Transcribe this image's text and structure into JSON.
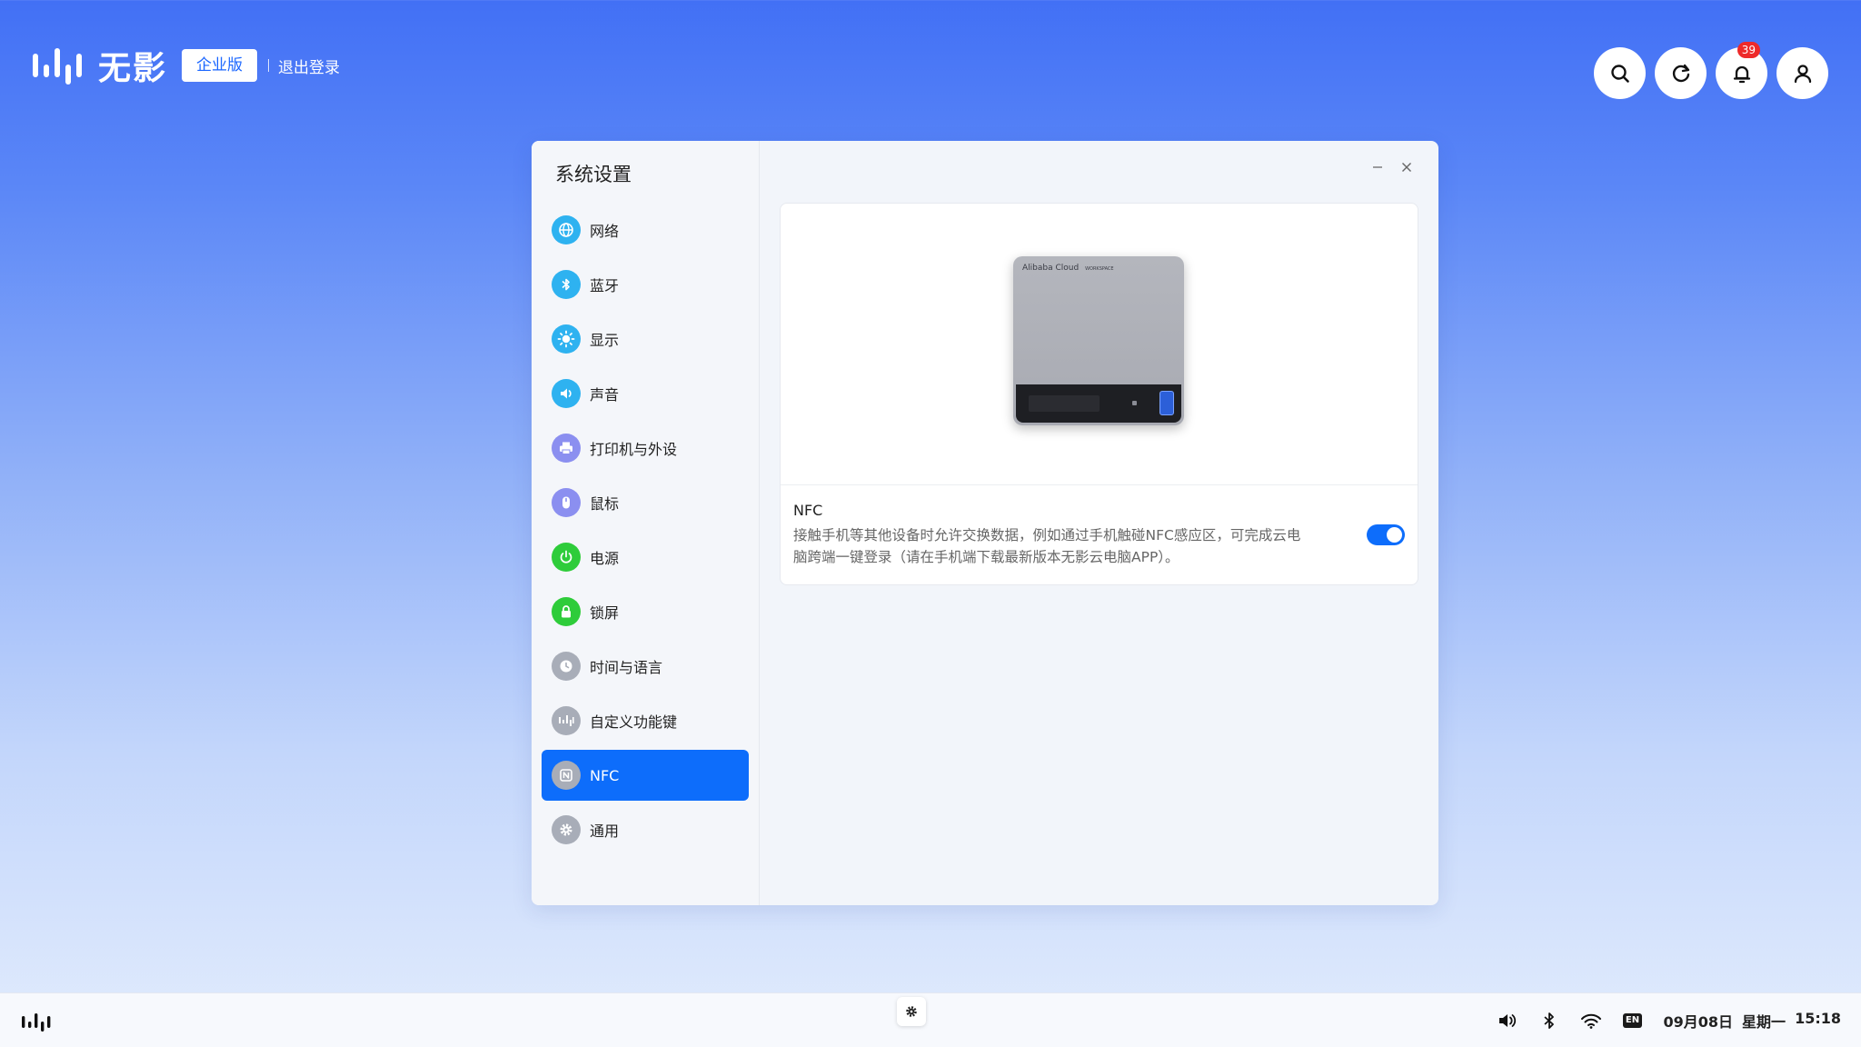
{
  "header": {
    "brand_name": "无影",
    "edition": "企业版",
    "logout": "退出登录",
    "notification_count": "39"
  },
  "settings": {
    "title": "系统设置",
    "menu": [
      {
        "label": "网络",
        "icon": "globe-icon",
        "color": "#2eb2f0"
      },
      {
        "label": "蓝牙",
        "icon": "bluetooth-icon",
        "color": "#2eb2f0"
      },
      {
        "label": "显示",
        "icon": "sun-icon",
        "color": "#2eb2f0"
      },
      {
        "label": "声音",
        "icon": "speaker-icon",
        "color": "#2eb2f0"
      },
      {
        "label": "打印机与外设",
        "icon": "printer-icon",
        "color": "#8b8ff0"
      },
      {
        "label": "鼠标",
        "icon": "mouse-icon",
        "color": "#8b8ff0"
      },
      {
        "label": "电源",
        "icon": "power-icon",
        "color": "#2ecc3a"
      },
      {
        "label": "锁屏",
        "icon": "lock-icon",
        "color": "#2ecc3a"
      },
      {
        "label": "时间与语言",
        "icon": "clock-icon",
        "color": "#a8adb8"
      },
      {
        "label": "自定义功能键",
        "icon": "logo-key-icon",
        "color": "#a8adb8"
      },
      {
        "label": "NFC",
        "icon": "nfc-icon",
        "color": "#a8adb8",
        "active": true
      },
      {
        "label": "通用",
        "icon": "gear-icon",
        "color": "#a8adb8"
      }
    ],
    "nfc": {
      "label": "NFC",
      "description": "接触手机等其他设备时允许交换数据，例如通过手机触碰NFC感应区，可完成云电脑跨端一键登录（请在手机端下载最新版本无影云电脑APP）。",
      "enabled": true,
      "device_brand": "Alibaba Cloud",
      "device_sub": "WORKSPACE"
    }
  },
  "taskbar": {
    "lang": "EN",
    "date": "09月08日",
    "weekday": "星期一",
    "time": "15:18"
  }
}
